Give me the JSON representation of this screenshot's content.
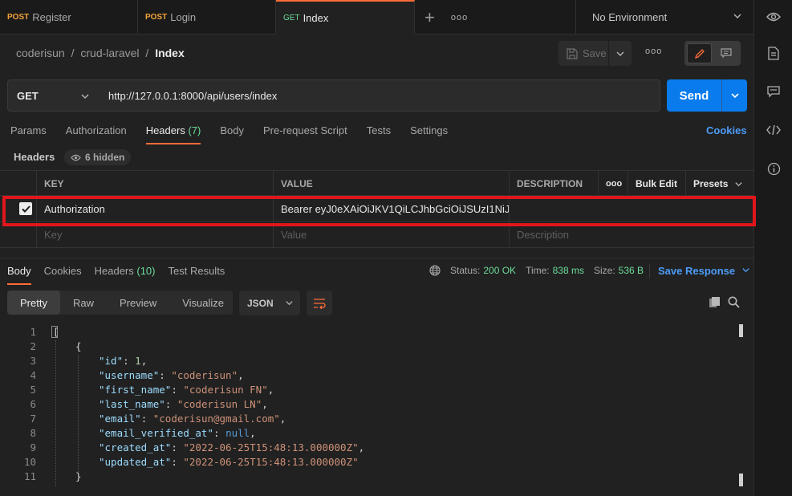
{
  "tabs": [
    {
      "method": "POST",
      "name": "Register"
    },
    {
      "method": "POST",
      "name": "Login"
    },
    {
      "method": "GET",
      "name": "Index"
    }
  ],
  "tab_actions": {
    "add": "+",
    "more": "ooo"
  },
  "environment": "No Environment",
  "breadcrumb": {
    "workspace": "coderisun",
    "collection": "crud-laravel",
    "request": "Index",
    "sep": "/"
  },
  "toolbar": {
    "save": "Save",
    "more": "ooo"
  },
  "request": {
    "method": "GET",
    "url": "http://127.0.0.1:8000/api/users/index",
    "send": "Send"
  },
  "request_tabs": [
    {
      "label": "Params"
    },
    {
      "label": "Authorization"
    },
    {
      "label": "Headers",
      "count": "(7)"
    },
    {
      "label": "Body"
    },
    {
      "label": "Pre-request Script"
    },
    {
      "label": "Tests"
    },
    {
      "label": "Settings"
    }
  ],
  "cookies_link": "Cookies",
  "headers": {
    "label": "Headers",
    "hidden": "6 hidden",
    "columns": {
      "key": "KEY",
      "value": "VALUE",
      "description": "DESCRIPTION",
      "more": "ooo",
      "bulk": "Bulk Edit",
      "presets": "Presets"
    },
    "rows": [
      {
        "key": "Authorization",
        "value": "Bearer eyJ0eXAiOiJKV1QiLCJhbGciOiJSUzI1NiJ...",
        "description": "",
        "checked": true
      }
    ],
    "placeholders": {
      "key": "Key",
      "value": "Value",
      "description": "Description"
    }
  },
  "response": {
    "tabs": [
      {
        "label": "Body"
      },
      {
        "label": "Cookies"
      },
      {
        "label": "Headers",
        "count": "(10)"
      },
      {
        "label": "Test Results"
      }
    ],
    "status_label": "Status:",
    "status": "200 OK",
    "time_label": "Time:",
    "time": "838 ms",
    "size_label": "Size:",
    "size": "536 B",
    "save": "Save Response",
    "views": [
      "Pretty",
      "Raw",
      "Preview",
      "Visualize"
    ],
    "format": "JSON",
    "line_numbers": [
      "1",
      "2",
      "3",
      "4",
      "5",
      "6",
      "7",
      "8",
      "9",
      "10",
      "11"
    ],
    "body": {
      "open_bracket": "[",
      "open_brace": "{",
      "close_brace": "}",
      "fields": [
        {
          "key": "\"id\"",
          "value": "1",
          "type": "num"
        },
        {
          "key": "\"username\"",
          "value": "\"coderisun\"",
          "type": "str"
        },
        {
          "key": "\"first_name\"",
          "value": "\"coderisun FN\"",
          "type": "str"
        },
        {
          "key": "\"last_name\"",
          "value": "\"coderisun LN\"",
          "type": "str"
        },
        {
          "key": "\"email\"",
          "value": "\"coderisun@gmail.com\"",
          "type": "str"
        },
        {
          "key": "\"email_verified_at\"",
          "value": "null",
          "type": "null"
        },
        {
          "key": "\"created_at\"",
          "value": "\"2022-06-25T15:48:13.000000Z\"",
          "type": "str"
        },
        {
          "key": "\"updated_at\"",
          "value": "\"2022-06-25T15:48:13.000000Z\"",
          "type": "str"
        }
      ]
    }
  },
  "colors": {
    "accent": "#ff6c37",
    "send": "#097bed",
    "get": "#6bdd9a",
    "post": "#f2a33a",
    "link": "#4d9cf8",
    "highlight": "#e0161c"
  }
}
